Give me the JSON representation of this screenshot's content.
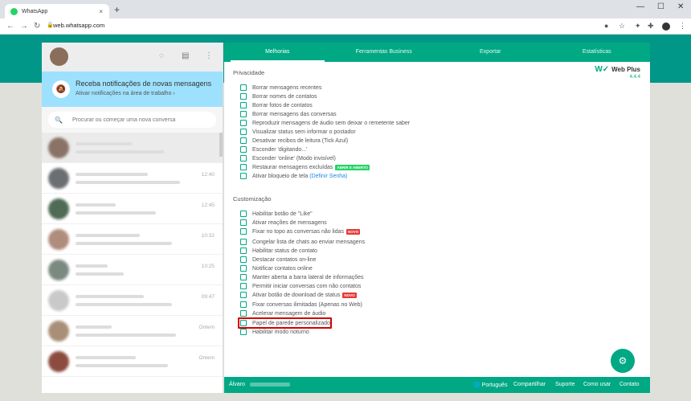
{
  "browser": {
    "tab_title": "WhatsApp",
    "tab_close": "×",
    "new_tab": "+",
    "url": "web.whatsapp.com",
    "win_minimize": "—",
    "win_maximize": "☐",
    "win_close": "✕"
  },
  "left": {
    "notification_title": "Receba notificações de novas mensagens",
    "notification_sub": "Ativar notificações na área de trabalho ›",
    "search_placeholder": "Procurar ou começar uma nova conversa",
    "chats": [
      {
        "time": ""
      },
      {
        "time": "12:40"
      },
      {
        "time": "12:45"
      },
      {
        "time": "10:32"
      },
      {
        "time": "10:25"
      },
      {
        "time": "09:47"
      },
      {
        "time": "Ontem"
      },
      {
        "time": "Ontem"
      }
    ]
  },
  "panel": {
    "tabs": [
      "Melhorias",
      "Ferramentas Business",
      "Exportar",
      "Estatísticas"
    ],
    "active_tab": "Melhorias",
    "logo_text": "Web Plus",
    "logo_version": "4.4.4",
    "privacy_title": "Privacidade",
    "privacy_options": [
      "Borrar mensagens recentes",
      "Borrar nomes de contatos",
      "Borrar fotos de contatos",
      "Borrar mensagens das conversas",
      "Reproduzir mensagens de áudio sem deixar o remetente saber",
      "Visualizar status sem informar o postador",
      "Desativar recibos de leitura (Tick Azul)",
      "Esconder 'digitando...'",
      "Esconder 'online' (Modo invisível)",
      "Restaurar mensagens excluídas",
      "Ativar bloqueio de tela"
    ],
    "restore_tag": "ABRIR E ABERTO",
    "lock_link": "(Definir Senha)",
    "custom_title": "Customização",
    "custom_options": [
      "Habilitar botão de \"Like\"",
      "Ativar reações de mensagens",
      "Fixar no topo as conversas não lidas",
      "Congelar lista de chats ao enviar mensagens",
      "Habilitar status de contato",
      "Destacar contatos on-line",
      "Notificar contatos online",
      "Manter aberta a barra lateral de informações",
      "Permitir iniciar conversas com não contatos",
      "Ativar botão de download de status",
      "Fixar conversas ilimitadas (Apenas no Web)",
      "Acelerar mensagem de áudio",
      "Papel de parede personalizado",
      "Habilitar modo noturno"
    ],
    "new_tag": "NOVO",
    "footer": {
      "user_label": "Álvaro",
      "language": "🌐 Português",
      "share": "Compartilhar",
      "support": "Suporte",
      "how_to": "Como usar",
      "contact": "Contato"
    }
  },
  "colors": {
    "brand": "#00a884",
    "highlight": "#d50000"
  }
}
